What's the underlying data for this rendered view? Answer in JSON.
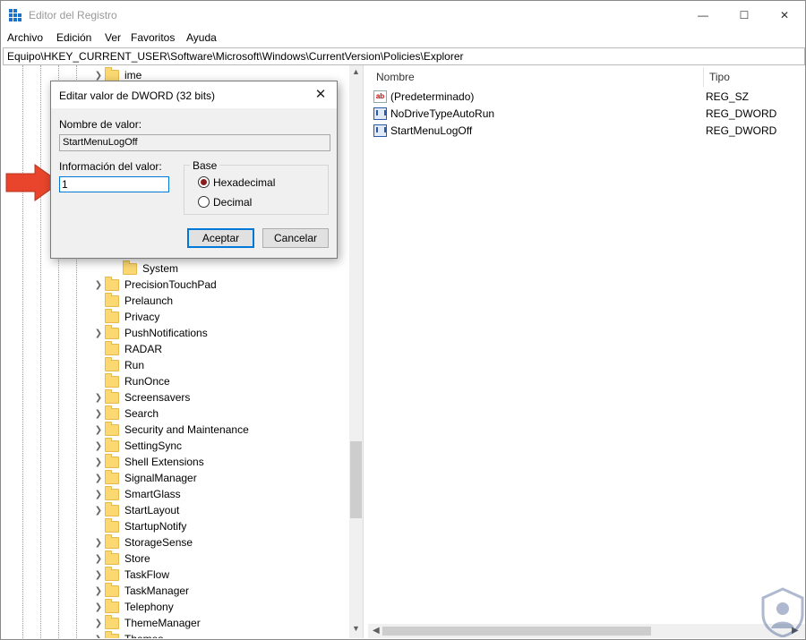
{
  "window": {
    "title": "Editor del Registro",
    "controls": {
      "minimize": "—",
      "maximize": "☐",
      "close": "✕"
    }
  },
  "menu": [
    "Archivo",
    "Edición",
    "Ver",
    "Favoritos",
    "Ayuda"
  ],
  "address": "Equipo\\HKEY_CURRENT_USER\\Software\\Microsoft\\Windows\\CurrentVersion\\Policies\\Explorer",
  "tree": {
    "top_item": "ime",
    "sub_item": "System",
    "items": [
      "PrecisionTouchPad",
      "Prelaunch",
      "Privacy",
      "PushNotifications",
      "RADAR",
      "Run",
      "RunOnce",
      "Screensavers",
      "Search",
      "Security and Maintenance",
      "SettingSync",
      "Shell Extensions",
      "SignalManager",
      "SmartGlass",
      "StartLayout",
      "StartupNotify",
      "StorageSense",
      "Store",
      "TaskFlow",
      "TaskManager",
      "Telephony",
      "ThemeManager",
      "Themes"
    ],
    "expandable": [
      true,
      false,
      false,
      true,
      false,
      false,
      false,
      true,
      true,
      true,
      true,
      true,
      true,
      true,
      true,
      false,
      true,
      true,
      true,
      true,
      true,
      true,
      true
    ]
  },
  "list": {
    "headers": {
      "name": "Nombre",
      "type": "Tipo"
    },
    "rows": [
      {
        "name": "(Predeterminado)",
        "type": "REG_SZ",
        "icon": "string-value-icon"
      },
      {
        "name": "NoDriveTypeAutoRun",
        "type": "REG_DWORD",
        "icon": "binary-value-icon"
      },
      {
        "name": "StartMenuLogOff",
        "type": "REG_DWORD",
        "icon": "binary-value-icon"
      }
    ]
  },
  "dialog": {
    "title": "Editar valor de DWORD (32 bits)",
    "close": "✕",
    "name_label": "Nombre de valor:",
    "name_value": "StartMenuLogOff",
    "data_label": "Información del valor:",
    "data_value": "1",
    "base_label": "Base",
    "hex_label": "Hexadecimal",
    "dec_label": "Decimal",
    "selected_base": "Hexadecimal",
    "ok_label": "Aceptar",
    "cancel_label": "Cancelar"
  },
  "colors": {
    "arrow": "#e8452c",
    "accent": "#0078d7",
    "folder": "#fbd872"
  }
}
